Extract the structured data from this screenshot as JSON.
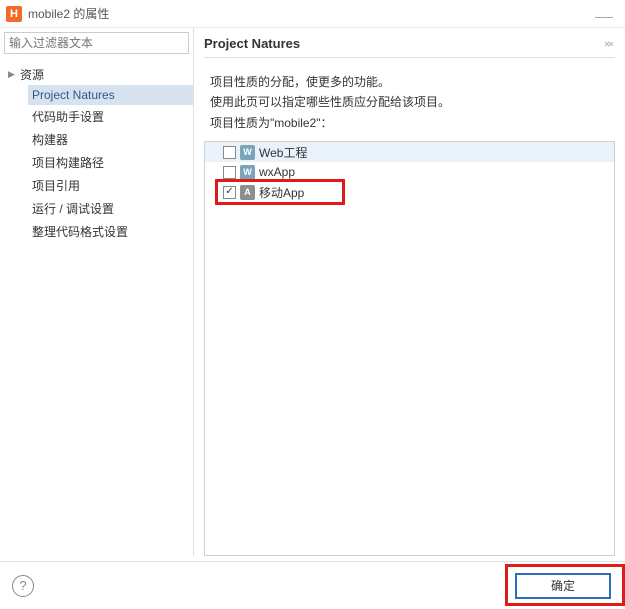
{
  "window": {
    "icon_letter": "H",
    "title": "mobile2 的属性"
  },
  "sidebar": {
    "filter_placeholder": "输入过滤器文本",
    "root_label": "资源",
    "items": [
      "Project Natures",
      "代码助手设置",
      "构建器",
      "项目构建路径",
      "项目引用",
      "运行 / 调试设置",
      "整理代码格式设置"
    ],
    "selected_index": 0
  },
  "main": {
    "title": "Project Natures",
    "desc_line1": "项目性质的分配，使更多的功能。",
    "desc_line2": "使用此页可以指定哪些性质应分配给该项目。",
    "desc_line3": "项目性质为\"mobile2\"：",
    "natures": [
      {
        "checked": false,
        "icon_bg": "w",
        "icon_letter": "W",
        "label": "Web工程",
        "selected": true
      },
      {
        "checked": false,
        "icon_bg": "w",
        "icon_letter": "W",
        "label": "wxApp",
        "selected": false
      },
      {
        "checked": true,
        "icon_bg": "a",
        "icon_letter": "A",
        "label": "移动App",
        "selected": false
      }
    ]
  },
  "footer": {
    "ok_label": "确定"
  }
}
